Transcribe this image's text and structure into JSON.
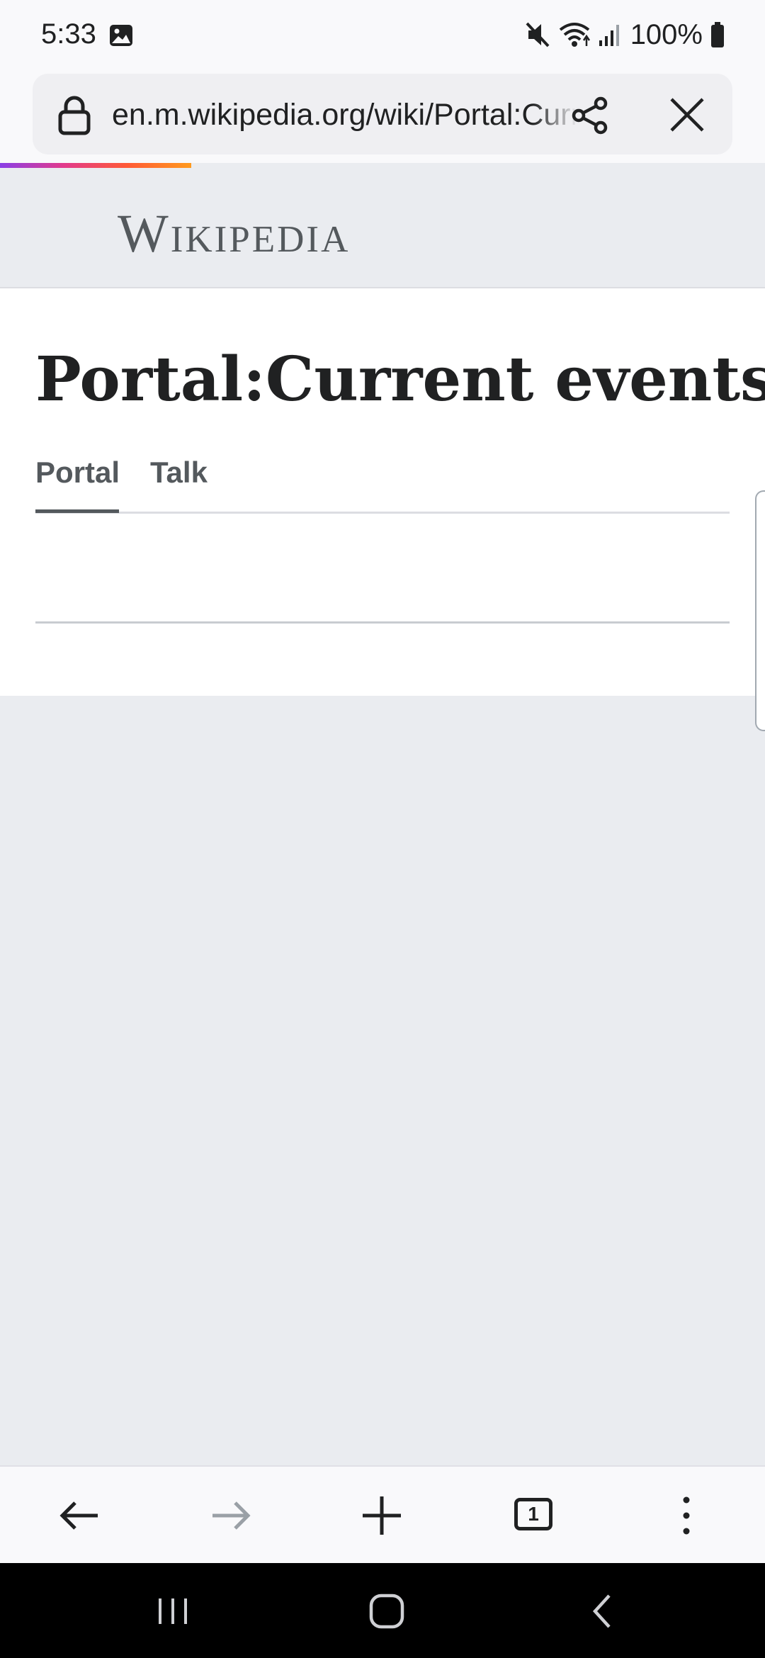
{
  "status_bar": {
    "time": "5:33",
    "battery": "100%",
    "icons": [
      "gallery-icon",
      "mute-icon",
      "wifi-icon",
      "signal-icon",
      "battery-icon"
    ]
  },
  "browser": {
    "url": "en.m.wikipedia.org/wiki/Portal:Current_events",
    "icons": [
      "lock-icon",
      "share-icon",
      "close-icon"
    ],
    "progress_fraction": 0.25
  },
  "wiki": {
    "wordmark": "Wikipedia",
    "page_title": "Portal:Current events",
    "tabs": [
      {
        "label": "Portal",
        "selected": true
      },
      {
        "label": "Talk",
        "selected": false
      }
    ]
  },
  "toolbar": {
    "tab_count": "1",
    "icons": [
      "back-arrow-icon",
      "forward-arrow-icon",
      "plus-icon",
      "tabs-icon",
      "more-vert-icon"
    ]
  },
  "nav_bar": {
    "icons": [
      "recent-apps-icon",
      "home-icon",
      "back-icon"
    ]
  },
  "colors": {
    "header_bg": "#eaecf0",
    "text": "#202122",
    "tab_text": "#54595d",
    "progress_gradient": [
      "#8a3fe6",
      "#e23a8c",
      "#ff5a36",
      "#ff9a1e"
    ]
  }
}
